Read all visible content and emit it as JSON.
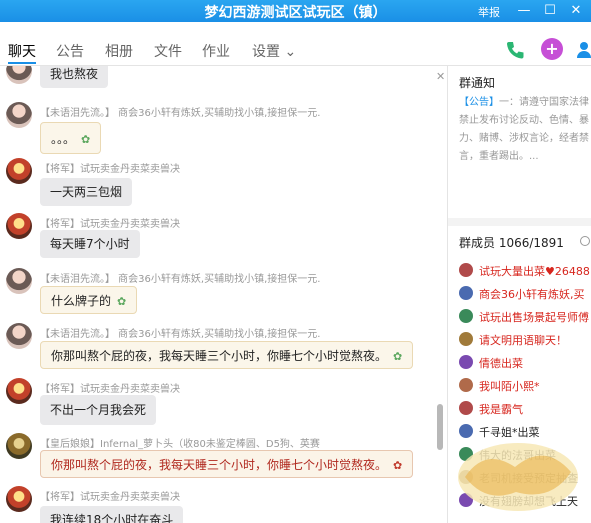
{
  "window": {
    "title": "梦幻西游测试区试玩区（镇）",
    "report_label": "举报",
    "minimize_glyph": "—",
    "maximize_glyph": "☐",
    "close_glyph": "✕"
  },
  "tabs": [
    {
      "label": "聊天",
      "active": true
    },
    {
      "label": "公告"
    },
    {
      "label": "相册"
    },
    {
      "label": "文件"
    },
    {
      "label": "作业"
    },
    {
      "label": "设置 ⌄"
    }
  ],
  "toolbar_icons": [
    "phone-icon",
    "add-app-icon",
    "add-member-icon"
  ],
  "messages": [
    {
      "author": "",
      "text": "我也熬夜",
      "style": "plain",
      "avatar": "a"
    },
    {
      "author": "【未语泪先流。】 商会36小轩有炼妖,买辅助找小镇,接担保一元.",
      "text": "。。。",
      "style": "paper",
      "avatar": "a"
    },
    {
      "author": "【将军】试玩卖金丹卖菜卖兽决",
      "text": "一天两三包烟",
      "style": "plain",
      "avatar": "b"
    },
    {
      "author": "【将军】试玩卖金丹卖菜卖兽决",
      "text": "每天睡7个小时",
      "style": "plain",
      "avatar": "b"
    },
    {
      "author": "【未语泪先流。】 商会36小轩有炼妖,买辅助找小镇,接担保一元.",
      "text": "什么牌子的",
      "style": "paper",
      "avatar": "a"
    },
    {
      "author": "【未语泪先流。】 商会36小轩有炼妖,买辅助找小镇,接担保一元.",
      "text": "你那叫熬个屁的夜，我每天睡三个小时，你睡七个小时觉熬夜。",
      "style": "paper",
      "avatar": "a"
    },
    {
      "author": "【将军】试玩卖金丹卖菜卖兽决",
      "text": "不出一个月我会死",
      "style": "plain",
      "avatar": "b"
    },
    {
      "author": "【皇后娘娘】Infernal_萝卜头（收80未鉴定棒圆、D5狗、英赛",
      "text": "你那叫熬个屁的夜，我每天睡三个小时，你睡七个小时觉熬夜。",
      "style": "red",
      "avatar": "c"
    },
    {
      "author": "【将军】试玩卖金丹卖菜卖兽决",
      "text": "我连续18个小时在奋斗",
      "style": "plain",
      "avatar": "b"
    }
  ],
  "notice": {
    "title": "群通知",
    "tag": "【公告】",
    "body": "一：请遵守国家法律禁止发布讨论反动、色情、暴力、赌博、涉权言论，经者禁言，重者踢出。..."
  },
  "members": {
    "title": "群成员 1066/1891",
    "items": [
      {
        "name": "试玩大量出菜♥26488",
        "color": "red"
      },
      {
        "name": "商会36小轩有炼妖,买",
        "color": "red"
      },
      {
        "name": "试玩出售场景起号师傅",
        "color": "red"
      },
      {
        "name": "请文明用语聊天！",
        "color": "red"
      },
      {
        "name": "倩德出菜",
        "color": "red"
      },
      {
        "name": "我叫陌小熙*",
        "color": "red"
      },
      {
        "name": "我是霸气",
        "color": "red"
      },
      {
        "name": "千寻姐*出菜",
        "color": "dark"
      },
      {
        "name": "伟大的法哥出菜",
        "color": "dark"
      },
      {
        "name": "老司机接受预定抽查",
        "color": "dark"
      },
      {
        "name": "没有翅膀却想飞上天",
        "color": "dark"
      }
    ]
  },
  "colors": {
    "accent": "#1a8fe6",
    "rank_red": "#d7261e"
  }
}
